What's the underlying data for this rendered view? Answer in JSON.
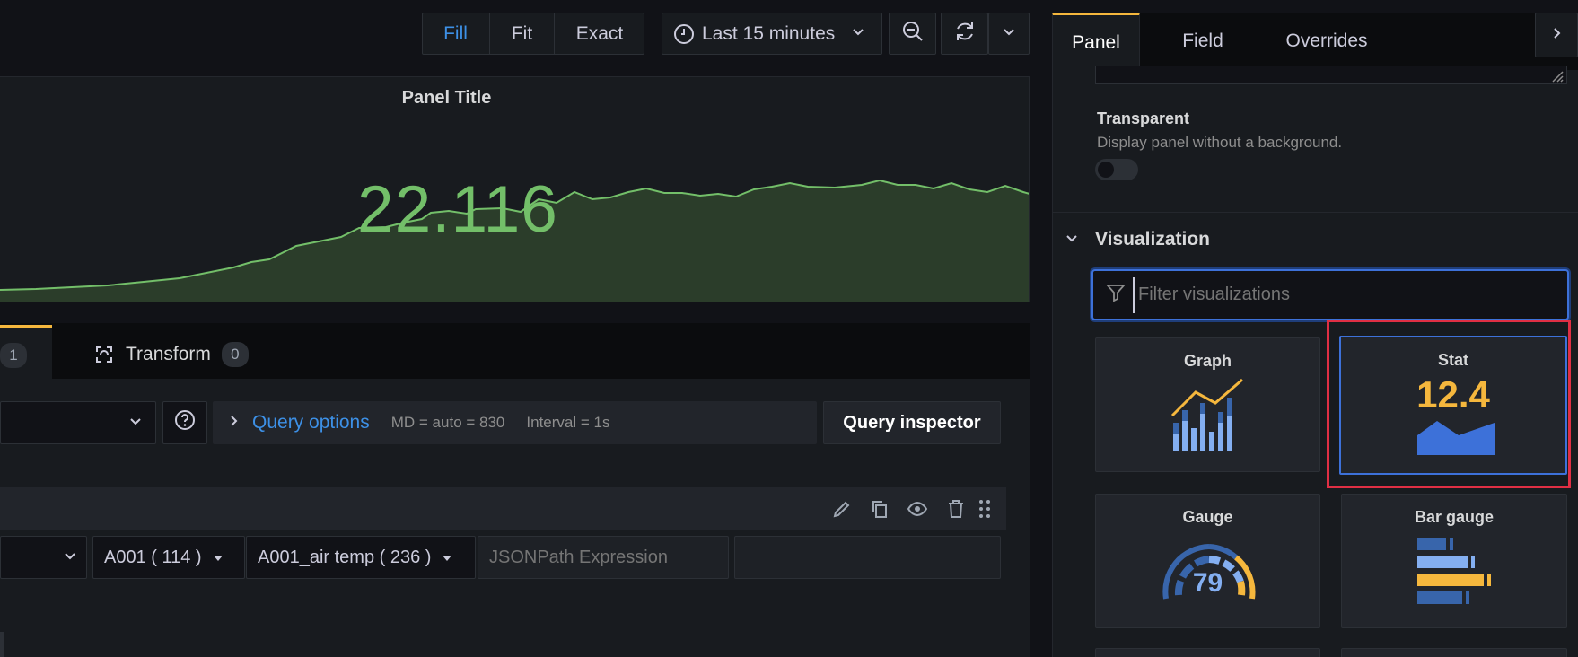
{
  "toolbar": {
    "fill": "Fill",
    "fit": "Fit",
    "exact": "Exact",
    "time_range": "Last 15 minutes"
  },
  "panel": {
    "title": "Panel Title",
    "stat_value": "22.116",
    "value_color": "#73bf69"
  },
  "editor_tabs": {
    "query_count": "1",
    "transform_label": "Transform",
    "transform_count": "0"
  },
  "query_options": {
    "label": "Query options",
    "md": "MD = auto = 830",
    "interval": "Interval = 1s",
    "inspector": "Query inspector"
  },
  "query": {
    "device": "A001 ( 114 )",
    "sensor": "A001_air temp ( 236 )",
    "jsonpath_placeholder": "JSONPath Expression"
  },
  "options_tabs": [
    "Panel",
    "Field",
    "Overrides"
  ],
  "display": {
    "transparent_label": "Transparent",
    "transparent_desc": "Display panel without a background."
  },
  "visualization": {
    "heading": "Visualization",
    "filter_placeholder": "Filter visualizations",
    "cards": [
      {
        "name": "Graph"
      },
      {
        "name": "Stat",
        "preview_value": "12.4"
      },
      {
        "name": "Gauge",
        "preview_value": "79"
      },
      {
        "name": "Bar gauge"
      }
    ]
  },
  "colors": {
    "accent_blue": "#3d90e6",
    "highlight_red": "#e02f44",
    "tab_orange": "#f5b73d"
  }
}
